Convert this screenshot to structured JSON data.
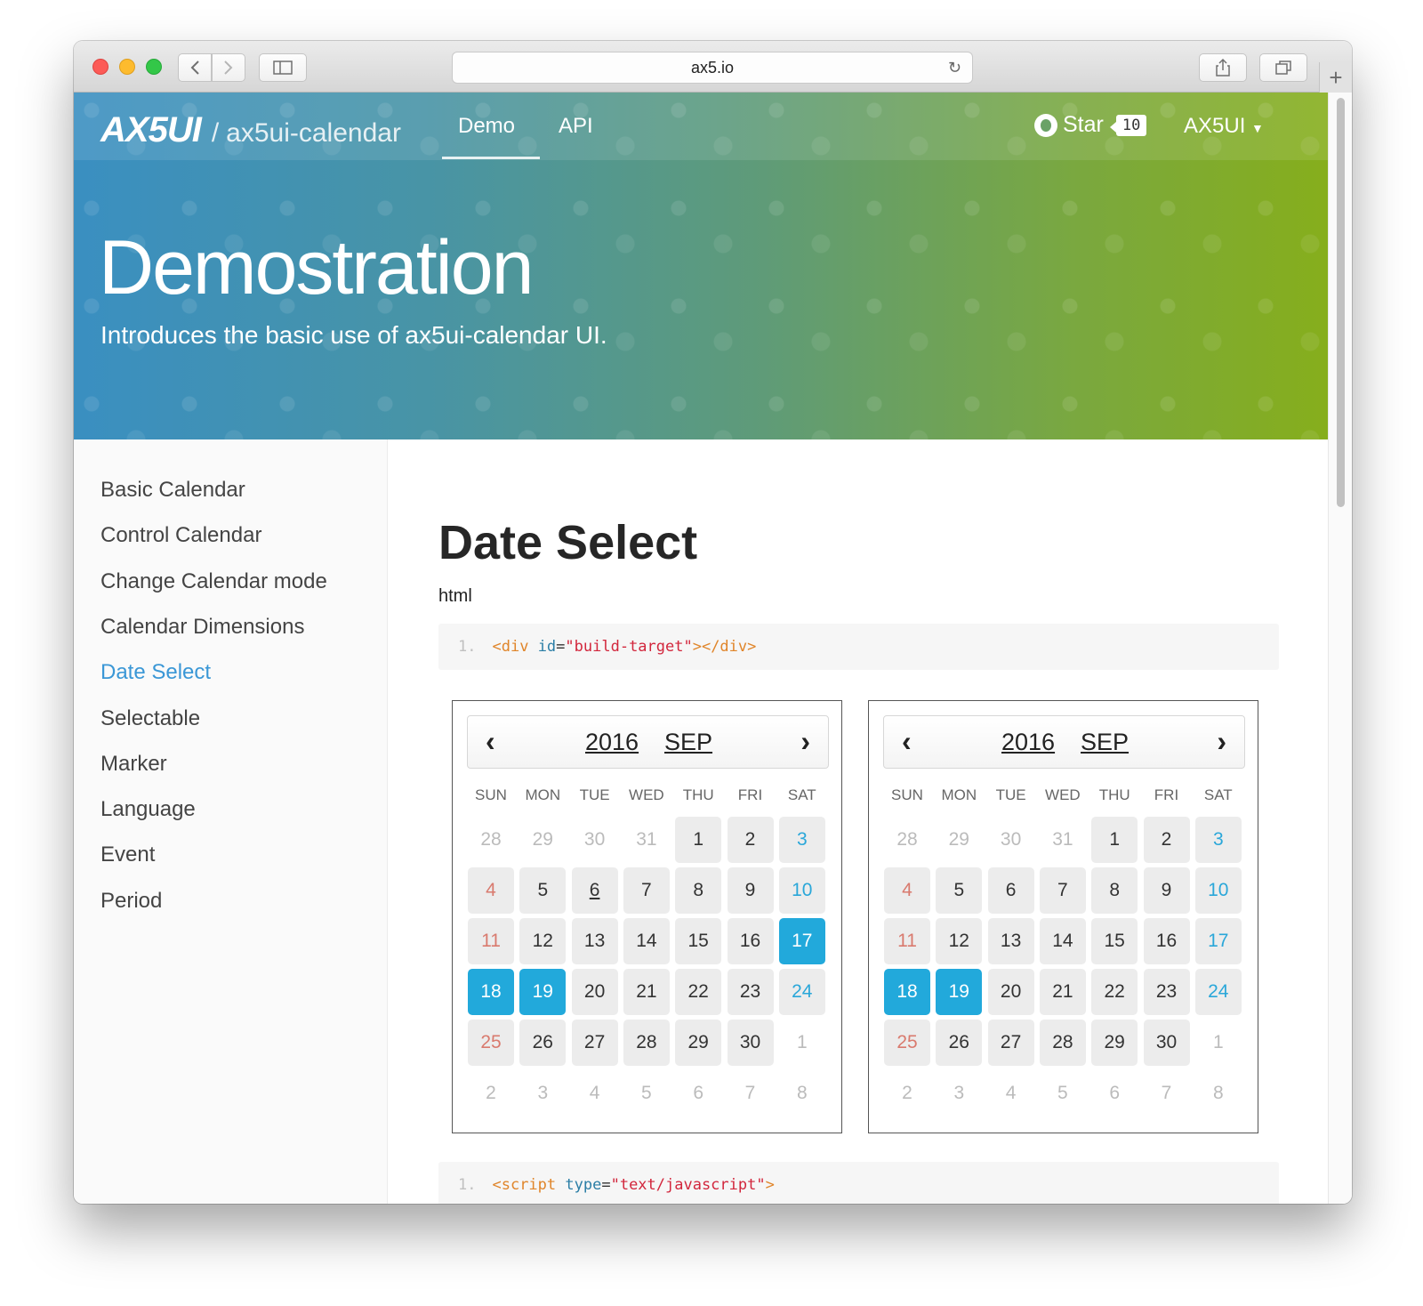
{
  "browser": {
    "url": "ax5.io"
  },
  "header": {
    "brand_logo": "AX5UI",
    "brand_sep": "/",
    "brand_sub": "ax5ui-calendar",
    "nav": [
      "Demo",
      "API"
    ],
    "star_label": "Star",
    "star_count": "10",
    "menu_label": "AX5UI"
  },
  "hero": {
    "title": "Demostration",
    "subtitle": "Introduces the basic use of ax5ui-calendar UI."
  },
  "sidebar": {
    "items": [
      {
        "label": "Basic Calendar"
      },
      {
        "label": "Control Calendar"
      },
      {
        "label": "Change Calendar mode"
      },
      {
        "label": "Calendar Dimensions"
      },
      {
        "label": "Date Select"
      },
      {
        "label": "Selectable"
      },
      {
        "label": "Marker"
      },
      {
        "label": "Language"
      },
      {
        "label": "Event"
      },
      {
        "label": "Period"
      }
    ],
    "active_index": 4
  },
  "main": {
    "title": "Date Select",
    "code_label": "html",
    "code_lines": [
      {
        "num": "1.",
        "tag_open": "<div",
        "attr": "id",
        "eq": "=",
        "str": "\"build-target\"",
        "tag_close": "></div>"
      },
      {
        "num": "1.",
        "tag_open": "<script",
        "attr": "type",
        "eq": "=",
        "str": "\"text/javascript\"",
        "tag_close": ">"
      }
    ]
  },
  "calendars": [
    {
      "year": "2016",
      "month": "SEP",
      "prev_symbol": "‹",
      "next_symbol": "›",
      "weekdays": [
        "SUN",
        "MON",
        "TUE",
        "WED",
        "THU",
        "FRI",
        "SAT"
      ],
      "days": [
        "28",
        "29",
        "30",
        "31",
        "1",
        "2",
        "3",
        "4",
        "5",
        "6",
        "7",
        "8",
        "9",
        "10",
        "11",
        "12",
        "13",
        "14",
        "15",
        "16",
        "17",
        "18",
        "19",
        "20",
        "21",
        "22",
        "23",
        "24",
        "25",
        "26",
        "27",
        "28",
        "29",
        "30",
        "1",
        "2",
        "3",
        "4",
        "5",
        "6",
        "7",
        "8"
      ],
      "selected": [
        "17",
        "18",
        "19"
      ],
      "today": "6"
    },
    {
      "year": "2016",
      "month": "SEP",
      "prev_symbol": "‹",
      "next_symbol": "›",
      "weekdays": [
        "SUN",
        "MON",
        "TUE",
        "WED",
        "THU",
        "FRI",
        "SAT"
      ],
      "days": [
        "28",
        "29",
        "30",
        "31",
        "1",
        "2",
        "3",
        "4",
        "5",
        "6",
        "7",
        "8",
        "9",
        "10",
        "11",
        "12",
        "13",
        "14",
        "15",
        "16",
        "17",
        "18",
        "19",
        "20",
        "21",
        "22",
        "23",
        "24",
        "25",
        "26",
        "27",
        "28",
        "29",
        "30",
        "1",
        "2",
        "3",
        "4",
        "5",
        "6",
        "7",
        "8"
      ],
      "selected": [
        "18",
        "19"
      ],
      "today": ""
    }
  ],
  "colors": {
    "accent": "#22a9db",
    "active_link": "#3a97d6",
    "sunday": "#d97a6e",
    "saturday": "#2aa7d9"
  }
}
